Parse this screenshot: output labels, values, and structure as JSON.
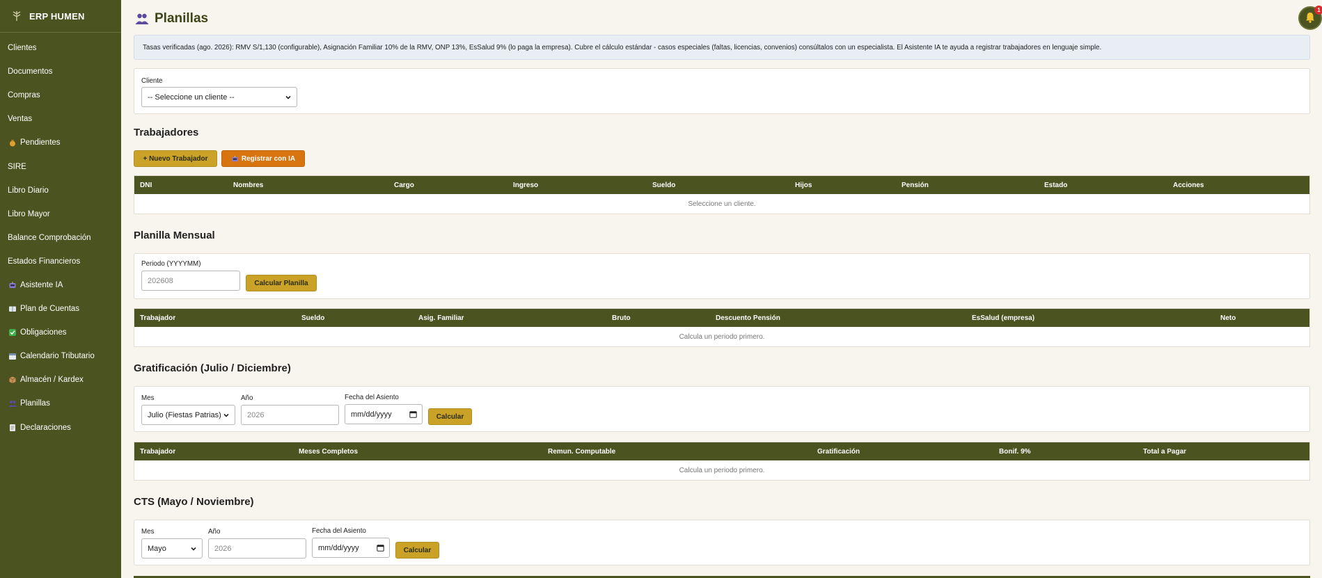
{
  "brand": {
    "title": "ERP HUMEN",
    "icon": "leaf-logo-icon"
  },
  "sidebar": {
    "items": [
      {
        "label": "Clientes",
        "icon": ""
      },
      {
        "label": "Documentos",
        "icon": ""
      },
      {
        "label": "Compras",
        "icon": ""
      },
      {
        "label": "Ventas",
        "icon": ""
      },
      {
        "label": "Pendientes",
        "icon": "money-bag-icon"
      },
      {
        "label": "SIRE",
        "icon": ""
      },
      {
        "label": "Libro Diario",
        "icon": ""
      },
      {
        "label": "Libro Mayor",
        "icon": ""
      },
      {
        "label": "Balance Comprobación",
        "icon": ""
      },
      {
        "label": "Estados Financieros",
        "icon": ""
      },
      {
        "label": "Asistente IA",
        "icon": "robot-icon"
      },
      {
        "label": "Plan de Cuentas",
        "icon": "book-icon"
      },
      {
        "label": "Obligaciones",
        "icon": "check-icon"
      },
      {
        "label": "Calendario Tributario",
        "icon": "calendar-icon"
      },
      {
        "label": "Almacén / Kardex",
        "icon": "box-icon"
      },
      {
        "label": "Planillas",
        "icon": "people-icon"
      },
      {
        "label": "Declaraciones",
        "icon": "document-icon"
      }
    ]
  },
  "header": {
    "title": "Planillas",
    "notifications_count": "1"
  },
  "notice": "Tasas verificadas (ago. 2026): RMV S/1,130 (configurable), Asignación Familiar 10% de la RMV, ONP 13%, EsSalud 9% (lo paga la empresa). Cubre el cálculo estándar - casos especiales (faltas, licencias, convenios) consúltalos con un especialista. El Asistente IA te ayuda a registrar trabajadores en lenguaje simple.",
  "client": {
    "label": "Cliente",
    "selected": "-- Seleccione un cliente --"
  },
  "workers": {
    "title": "Trabajadores",
    "new_button": "+ Nuevo Trabajador",
    "ai_button": "Registrar con IA",
    "columns": [
      "DNI",
      "Nombres",
      "Cargo",
      "Ingreso",
      "Sueldo",
      "Hijos",
      "Pensión",
      "Estado",
      "Acciones"
    ],
    "empty": "Seleccione un cliente."
  },
  "payroll": {
    "title": "Planilla Mensual",
    "period_label": "Periodo (YYYYMM)",
    "period_placeholder": "202608",
    "calc_button": "Calcular Planilla",
    "columns": [
      "Trabajador",
      "Sueldo",
      "Asig. Familiar",
      "Bruto",
      "Descuento Pensión",
      "EsSalud (empresa)",
      "Neto"
    ],
    "empty": "Calcula un periodo primero."
  },
  "bonus": {
    "title": "Gratificación (Julio / Diciembre)",
    "month_label": "Mes",
    "month_selected": "Julio (Fiestas Patrias)",
    "year_label": "Año",
    "year_placeholder": "2026",
    "date_label": "Fecha del Asiento",
    "date_placeholder": "mm/dd/yyyy",
    "calc_button": "Calcular",
    "columns": [
      "Trabajador",
      "Meses Completos",
      "Remun. Computable",
      "Gratificación",
      "Bonif. 9%",
      "Total a Pagar"
    ],
    "empty": "Calcula un periodo primero."
  },
  "cts": {
    "title": "CTS (Mayo / Noviembre)",
    "month_label": "Mes",
    "month_selected": "Mayo",
    "year_label": "Año",
    "year_placeholder": "2026",
    "date_label": "Fecha del Asiento",
    "date_placeholder": "mm/dd/yyyy",
    "calc_button": "Calcular"
  },
  "colors": {
    "sidebar": "#4b5320",
    "accent": "#c9a227",
    "orange": "#d7740f",
    "background": "#f8f5ee"
  }
}
